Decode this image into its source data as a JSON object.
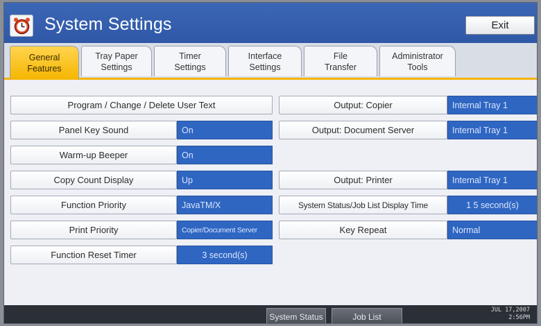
{
  "window": {
    "title": "System Settings",
    "exit_label": "Exit"
  },
  "tabs": [
    {
      "label": "General\nFeatures",
      "active": true
    },
    {
      "label": "Tray Paper\nSettings",
      "active": false
    },
    {
      "label": "Timer\nSettings",
      "active": false
    },
    {
      "label": "Interface\nSettings",
      "active": false
    },
    {
      "label": "File\nTransfer",
      "active": false
    },
    {
      "label": "Administrator\nTools",
      "active": false
    }
  ],
  "left_settings": [
    {
      "label": "Program / Change / Delete User Text",
      "value": ""
    },
    {
      "label": "Panel Key Sound",
      "value": "On"
    },
    {
      "label": "Warm-up Beeper",
      "value": "On"
    },
    {
      "label": "Copy Count Display",
      "value": "Up"
    },
    {
      "label": "Function Priority",
      "value": "JavaTM/X"
    },
    {
      "label": "Print Priority",
      "value": "Copier/Document Server"
    },
    {
      "label": "Function Reset Timer",
      "value": "3  second(s)"
    }
  ],
  "right_settings": [
    {
      "label": "Output: Copier",
      "value": "Internal Tray 1"
    },
    {
      "label": "Output: Document Server",
      "value": "Internal Tray 1"
    },
    {
      "label": "Output: Printer",
      "value": "Internal Tray 1"
    },
    {
      "label": "System Status/Job List Display Time",
      "value": "1 5  second(s)"
    },
    {
      "label": "Key Repeat",
      "value": "Normal"
    }
  ],
  "bottom": {
    "system_status": "System Status",
    "job_list": "Job List",
    "date": "JUL  17,2007",
    "time": "2:56PM"
  },
  "colors": {
    "titlebar": "#2d56a5",
    "active_tab": "#f5b600",
    "value_field": "#2f66c2"
  }
}
